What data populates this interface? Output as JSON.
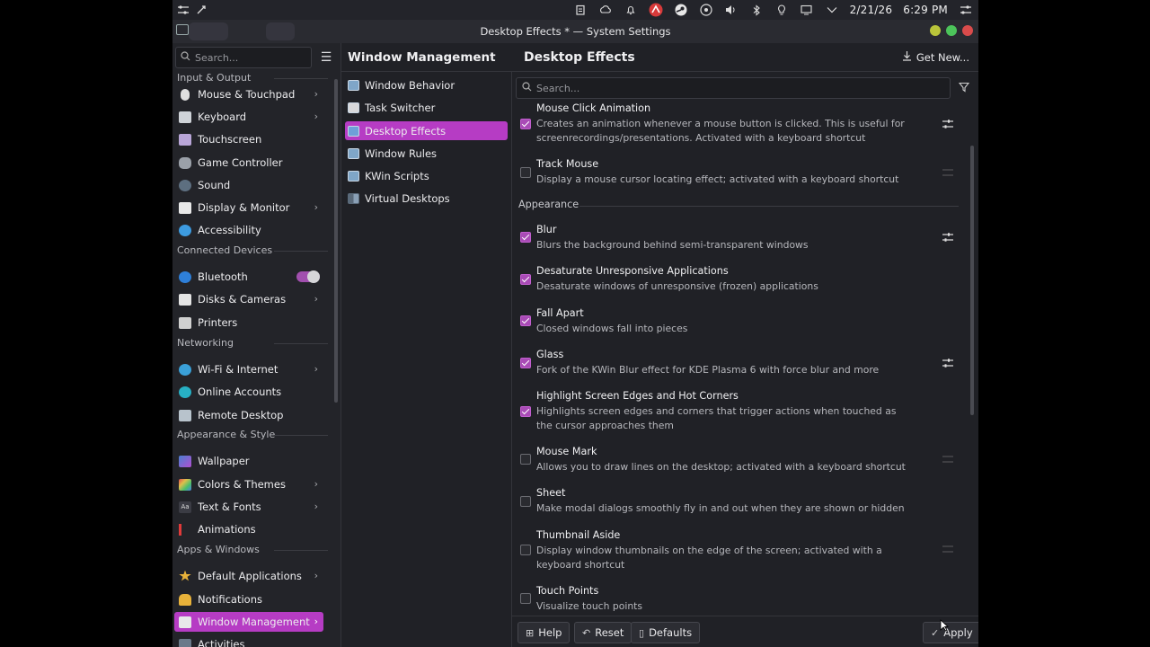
{
  "panel": {
    "date": "2/21/26",
    "time": "6:29 PM"
  },
  "window": {
    "title": "Desktop Effects * — System Settings"
  },
  "sidebar": {
    "search_placeholder": "Search...",
    "partial_header": "Input & Output",
    "items": [
      {
        "label": "Mouse & Touchpad",
        "icon": "mouse-icon",
        "chevron": true
      },
      {
        "label": "Keyboard",
        "icon": "keyboard-icon",
        "chevron": true
      },
      {
        "label": "Touchscreen",
        "icon": "touchscreen-icon",
        "chevron": false
      },
      {
        "label": "Game Controller",
        "icon": "gamepad-icon",
        "chevron": false
      },
      {
        "label": "Sound",
        "icon": "speaker-icon",
        "chevron": false
      },
      {
        "label": "Display & Monitor",
        "icon": "monitor-icon",
        "chevron": true
      },
      {
        "label": "Accessibility",
        "icon": "accessibility-icon",
        "chevron": false
      }
    ],
    "groups": [
      {
        "header": "Connected Devices"
      },
      {
        "header": "Networking"
      },
      {
        "header": "Appearance & Style"
      },
      {
        "header": "Apps & Windows"
      }
    ],
    "devices": [
      {
        "label": "Bluetooth"
      },
      {
        "label": "Disks & Cameras"
      },
      {
        "label": "Printers"
      }
    ],
    "networking": [
      {
        "label": "Wi-Fi & Internet"
      },
      {
        "label": "Online Accounts"
      },
      {
        "label": "Remote Desktop"
      }
    ],
    "appearance": [
      {
        "label": "Wallpaper"
      },
      {
        "label": "Colors & Themes"
      },
      {
        "label": "Text & Fonts"
      },
      {
        "label": "Animations"
      }
    ],
    "apps": [
      {
        "label": "Default Applications"
      },
      {
        "label": "Notifications"
      },
      {
        "label": "Window Management"
      },
      {
        "label": "Activities"
      }
    ]
  },
  "middle": {
    "title": "Window Management",
    "items": [
      {
        "label": "Window Behavior"
      },
      {
        "label": "Task Switcher"
      },
      {
        "label": "Desktop Effects"
      },
      {
        "label": "Window Rules"
      },
      {
        "label": "KWin Scripts"
      },
      {
        "label": "Virtual Desktops"
      }
    ]
  },
  "right": {
    "title": "Desktop Effects",
    "get_new": "Get New...",
    "search_placeholder": "Search...",
    "group_appearance": "Appearance",
    "effects": [
      {
        "name": "Mouse Click Animation",
        "desc": "Creates an animation whenever a mouse button is clicked. This is useful for screenrecordings/presentations. Activated with a keyboard shortcut",
        "checked": true,
        "configurable": true
      },
      {
        "name": "Track Mouse",
        "desc": "Display a mouse cursor locating effect; activated with a keyboard shortcut",
        "checked": false,
        "configurable": false
      },
      {
        "name": "Blur",
        "desc": "Blurs the background behind semi-transparent windows",
        "checked": true,
        "configurable": true
      },
      {
        "name": "Desaturate Unresponsive Applications",
        "desc": "Desaturate windows of unresponsive (frozen) applications",
        "checked": true,
        "configurable": false
      },
      {
        "name": "Fall Apart",
        "desc": "Closed windows fall into pieces",
        "checked": true,
        "configurable": false
      },
      {
        "name": "Glass",
        "desc": "Fork of the KWin Blur effect for KDE Plasma 6 with force blur and more",
        "checked": true,
        "configurable": true
      },
      {
        "name": "Highlight Screen Edges and Hot Corners",
        "desc": "Highlights screen edges and corners that trigger actions when touched as the cursor approaches them",
        "checked": true,
        "configurable": false
      },
      {
        "name": "Mouse Mark",
        "desc": "Allows you to draw lines on the desktop; activated with a keyboard shortcut",
        "checked": false,
        "configurable": false
      },
      {
        "name": "Sheet",
        "desc": "Make modal dialogs smoothly fly in and out when they are shown or hidden",
        "checked": false,
        "configurable": false
      },
      {
        "name": "Thumbnail Aside",
        "desc": "Display window thumbnails on the edge of the screen; activated with a keyboard shortcut",
        "checked": false,
        "configurable": false
      },
      {
        "name": "Touch Points",
        "desc": "Visualize touch points",
        "checked": false,
        "configurable": false
      }
    ]
  },
  "buttons": {
    "help": "Help",
    "reset": "Reset",
    "defaults": "Defaults",
    "apply": "Apply"
  },
  "colors": {
    "accent": "#b63cc4",
    "checkbox_on": "#a94bb6",
    "window_bg": "#202126"
  }
}
